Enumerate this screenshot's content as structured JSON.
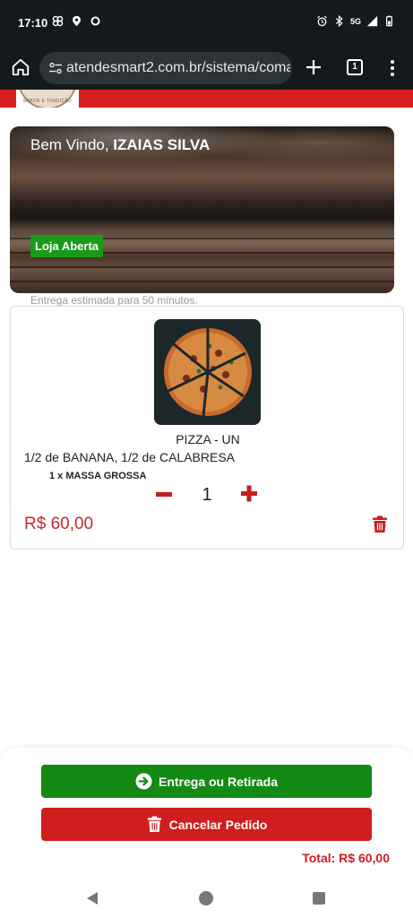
{
  "status_bar": {
    "time": "17:10",
    "network": "5G",
    "icons": [
      "fan-icon",
      "location-icon",
      "circle-icon",
      "alarm-icon",
      "bluetooth-icon",
      "signal-icon",
      "battery-icon"
    ]
  },
  "browser": {
    "url": "atendesmart2.com.br/sistema/comand",
    "tab_count": "1"
  },
  "header": {
    "logo_text": "SABOR E TRADIÇÃO",
    "accent_color": "#d71f1f"
  },
  "hero": {
    "welcome_prefix": "Bem Vindo, ",
    "user_name": "IZAIAS SILVA",
    "store_status": "Loja Aberta"
  },
  "delivery_estimate": "Entrega estimada para 50 minutos.",
  "cart_item": {
    "product": "PIZZA - UN",
    "description": "1/2 de BANANA, 1/2 de CALABRESA",
    "extra": "1 x MASSA GROSSA",
    "quantity": "1",
    "price": "R$ 60,00"
  },
  "actions": {
    "delivery_button": "Entrega ou Retirada",
    "cancel_button": "Cancelar Pedido",
    "total": "Total: R$ 60,00"
  },
  "colors": {
    "primary_red": "#d01d1d",
    "primary_green": "#138a13",
    "price_red": "#c42a2a"
  }
}
